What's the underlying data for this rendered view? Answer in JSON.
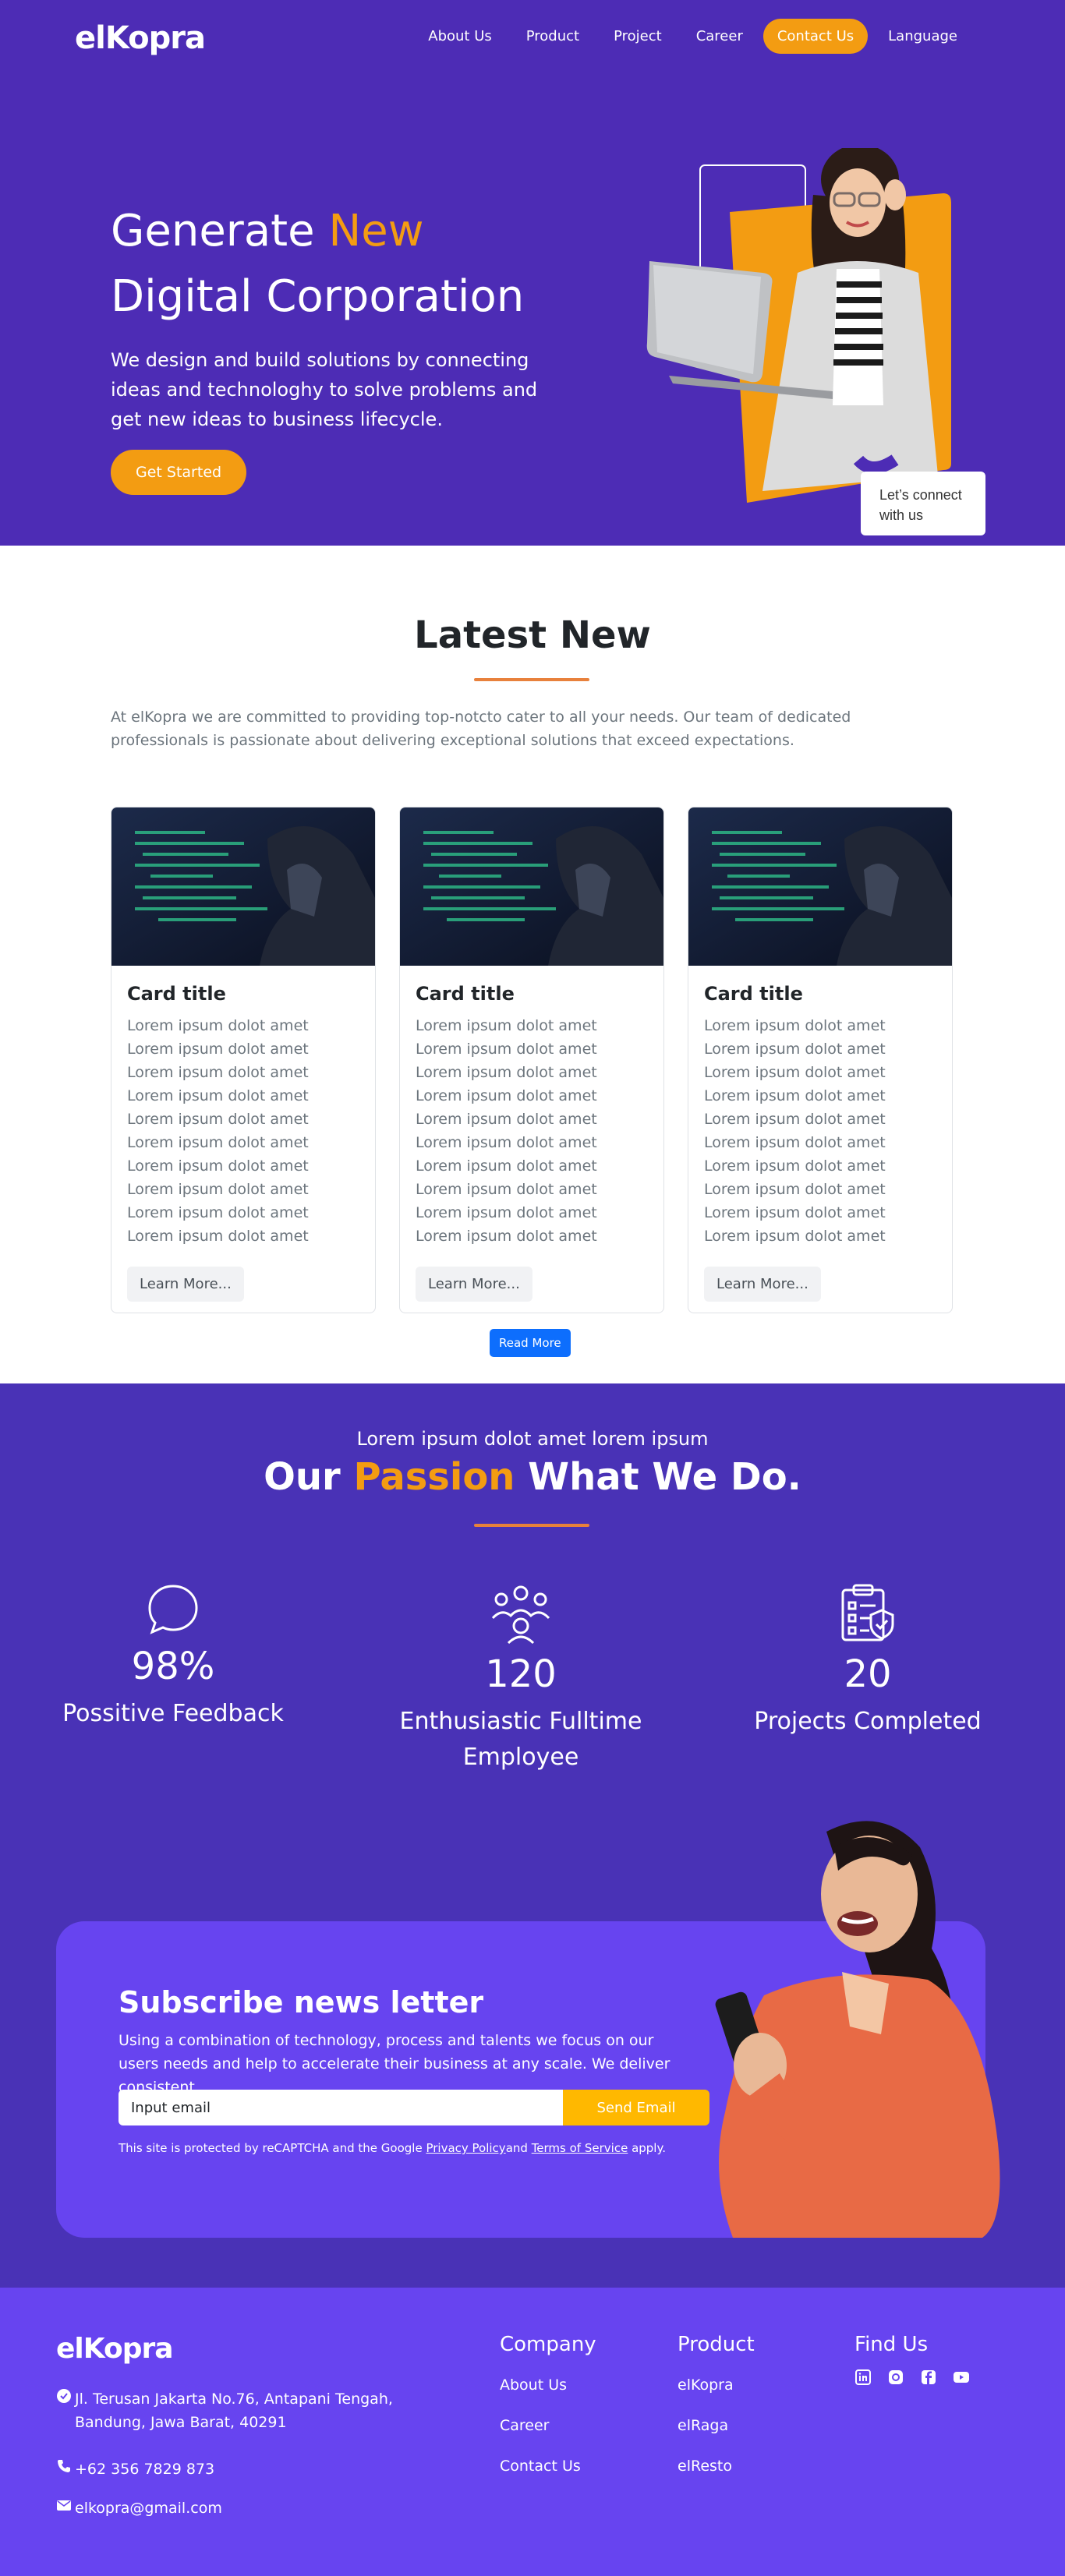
{
  "brand": {
    "name": "elKopra"
  },
  "nav": {
    "items": [
      {
        "label": "About Us"
      },
      {
        "label": "Product"
      },
      {
        "label": "Project"
      },
      {
        "label": "Career"
      },
      {
        "label": "Contact Us"
      },
      {
        "label": "Language"
      }
    ]
  },
  "hero": {
    "title_part1": "Generate ",
    "title_accent": "New",
    "title_line2": "Digital Corporation",
    "description": "We design and build solutions by connecting ideas and technologhy to solve problems and get new ideas to business lifecycle.",
    "cta": "Get Started",
    "connect_label": "Let's connect with us"
  },
  "latest": {
    "title": "Latest New",
    "description": "At elKopra we are committed to providing top-notcto cater to all your needs. Our team of dedicated professionals is passionate about delivering exceptional solutions that exceed expectations.",
    "cards": [
      {
        "title": "Card title",
        "text": "Lorem ipsum dolot amet Lorem ipsum dolot amet Lorem ipsum dolot amet Lorem ipsum dolot amet Lorem ipsum dolot amet Lorem ipsum dolot amet Lorem ipsum dolot amet Lorem ipsum dolot amet Lorem ipsum dolot amet Lorem ipsum dolot amet",
        "button": "Learn More..."
      },
      {
        "title": "Card title",
        "text": "Lorem ipsum dolot amet Lorem ipsum dolot amet Lorem ipsum dolot amet Lorem ipsum dolot amet Lorem ipsum dolot amet Lorem ipsum dolot amet Lorem ipsum dolot amet Lorem ipsum dolot amet Lorem ipsum dolot amet Lorem ipsum dolot amet",
        "button": "Learn More..."
      },
      {
        "title": "Card title",
        "text": "Lorem ipsum dolot amet Lorem ipsum dolot amet Lorem ipsum dolot amet Lorem ipsum dolot amet Lorem ipsum dolot amet Lorem ipsum dolot amet Lorem ipsum dolot amet Lorem ipsum dolot amet Lorem ipsum dolot amet Lorem ipsum dolot amet",
        "button": "Learn More..."
      }
    ],
    "read_more": "Read More"
  },
  "passion": {
    "kicker": "Lorem ipsum dolot amet lorem ipsum",
    "title_part1": "Our ",
    "title_accent": "Passion",
    "title_part2": " What We Do.",
    "stats": [
      {
        "icon": "chat-bubble-icon",
        "value": "98%",
        "label": "Possitive Feedback"
      },
      {
        "icon": "people-group-icon",
        "value": "120",
        "label": "Enthusiastic Fulltime Employee"
      },
      {
        "icon": "clipboard-check-icon",
        "value": "20",
        "label": "Projects Completed"
      }
    ]
  },
  "subscribe": {
    "title": "Subscribe news letter",
    "description": "Using a combination of technology, process and talents we focus on our users needs and help to accelerate their business at any scale. We deliver consistent",
    "placeholder": "Input email",
    "button": "Send Email",
    "note_prefix": "This site is protected by reCAPTCHA and the Google ",
    "privacy": "Privacy Policy",
    "note_and": "and ",
    "terms": "Terms of Service",
    "note_suffix": " apply."
  },
  "footer": {
    "address": "Jl. Terusan Jakarta No.76, Antapani Tengah, Bandung, Jawa Barat, 40291",
    "phone": "+62 356 7829 873",
    "email": "elkopra@gmail.com",
    "company": {
      "title": "Company",
      "links": [
        "About Us",
        "Career",
        "Contact Us"
      ]
    },
    "product": {
      "title": "Product",
      "links": [
        "elKopra",
        "elRaga",
        "elResto"
      ]
    },
    "find_us": {
      "title": "Find Us",
      "icons": [
        "linkedin-icon",
        "instagram-icon",
        "facebook-icon",
        "youtube-icon"
      ]
    }
  },
  "colors": {
    "hero_bg": "#4d2cb5",
    "accent": "#f39c12",
    "section_bg": "#4932b6",
    "footer_bg": "#6744f0",
    "link_blue": "#0d6efd"
  }
}
